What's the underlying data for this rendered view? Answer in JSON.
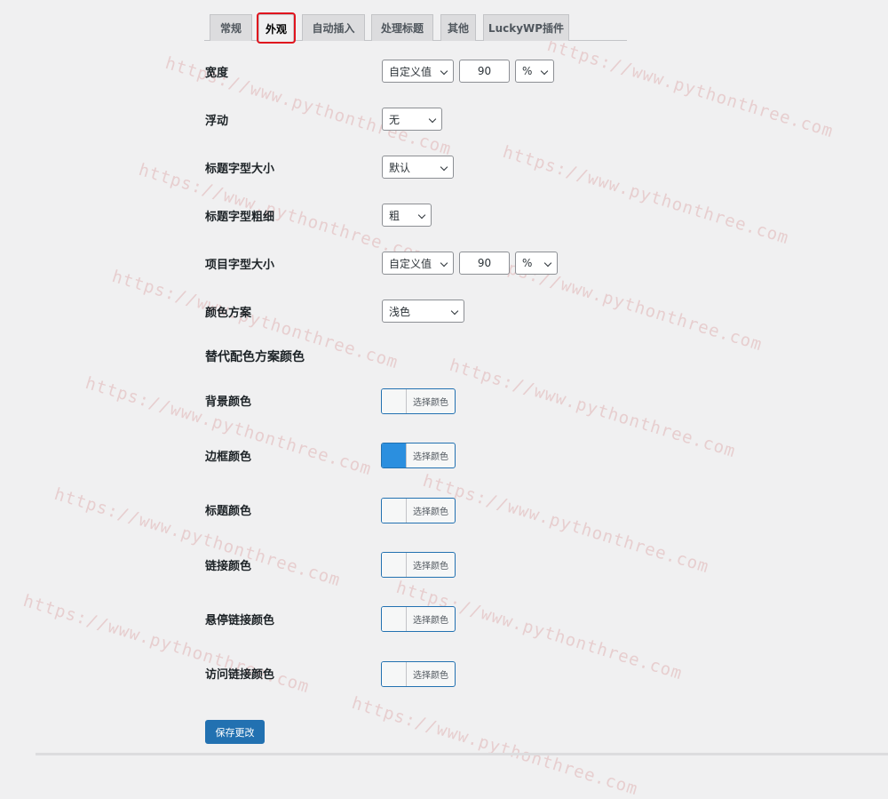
{
  "tabs": [
    {
      "label": "常规"
    },
    {
      "label": "外观"
    },
    {
      "label": "自动插入"
    },
    {
      "label": "处理标题"
    },
    {
      "label": "其他"
    },
    {
      "label": "LuckyWP插件"
    }
  ],
  "active_tab": "外观",
  "fields": {
    "width": {
      "label": "宽度",
      "mode": "自定义值",
      "value": "90",
      "unit": "%"
    },
    "float": {
      "label": "浮动",
      "value": "无"
    },
    "title_font_size": {
      "label": "标题字型大小",
      "value": "默认"
    },
    "title_font_weight": {
      "label": "标题字型粗细",
      "value": "粗"
    },
    "item_font_size": {
      "label": "项目字型大小",
      "mode": "自定义值",
      "value": "90",
      "unit": "%"
    },
    "color_scheme": {
      "label": "颜色方案",
      "value": "浅色"
    }
  },
  "alt_colors": {
    "heading": "替代配色方案颜色",
    "button_label": "选择颜色",
    "items": [
      {
        "label": "背景颜色",
        "color": "#f6f7f7"
      },
      {
        "label": "边框颜色",
        "color": "#2b8fdf"
      },
      {
        "label": "标题颜色",
        "color": "#f6f7f7"
      },
      {
        "label": "链接颜色",
        "color": "#f6f7f7"
      },
      {
        "label": "悬停链接颜色",
        "color": "#f6f7f7"
      },
      {
        "label": "访问链接颜色",
        "color": "#f6f7f7"
      }
    ]
  },
  "save_label": "保存更改",
  "watermark": "https://www.pythonthree.com",
  "colors": {
    "accent": "#2271b1",
    "highlight": "#e0141e",
    "background": "#f0f0f1"
  }
}
